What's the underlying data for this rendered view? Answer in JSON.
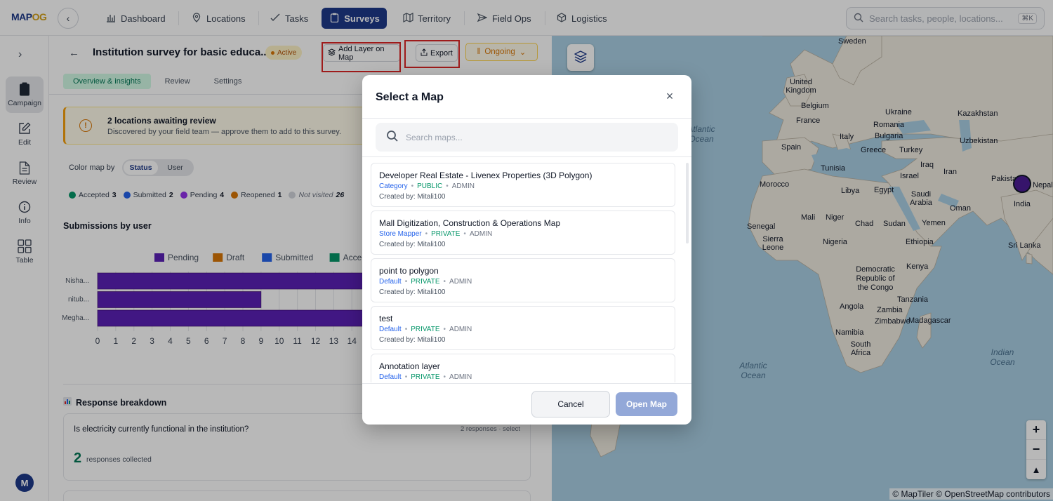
{
  "brand": {
    "logo_left": "MAP",
    "logo_accent": "OG"
  },
  "nav": {
    "items": [
      {
        "label": "Dashboard",
        "icon": "bar-chart-icon"
      },
      {
        "label": "Locations",
        "icon": "pin-icon"
      },
      {
        "label": "Tasks",
        "icon": "check-icon"
      },
      {
        "label": "Surveys",
        "icon": "clipboard-icon",
        "active": true
      },
      {
        "label": "Territory",
        "icon": "map-icon"
      },
      {
        "label": "Field Ops",
        "icon": "send-icon"
      },
      {
        "label": "Logistics",
        "icon": "cube-icon"
      }
    ],
    "search_placeholder": "Search tasks, people, locations...",
    "search_kbd": "⌘K"
  },
  "rail": {
    "items": [
      {
        "label": "Campaign",
        "icon": "clipboard-icon",
        "active": true
      },
      {
        "label": "Edit",
        "icon": "edit-icon"
      },
      {
        "label": "Review",
        "icon": "document-icon"
      },
      {
        "label": "Info",
        "icon": "info-icon"
      },
      {
        "label": "Table",
        "icon": "grid-icon"
      }
    ],
    "avatar": "M"
  },
  "survey": {
    "title": "Institution survey for basic educa...",
    "status_badge": "Active",
    "add_layer_label": "Add Layer on Map",
    "export_label": "Export",
    "ongoing_label": "Ongoing",
    "tabs": [
      "Overview & insights",
      "Review",
      "Settings"
    ],
    "alert": {
      "title": "2 locations awaiting review",
      "subtitle": "Discovered by your field team — approve them to add to this survey."
    },
    "color_map_by": "Color map by",
    "color_options": [
      "Status",
      "User"
    ],
    "status_legend": [
      {
        "label": "Accepted",
        "count": "3",
        "color": "#059669"
      },
      {
        "label": "Submitted",
        "count": "2",
        "color": "#2563eb"
      },
      {
        "label": "Pending",
        "count": "4",
        "color": "#9333ea"
      },
      {
        "label": "Reopened",
        "count": "1",
        "color": "#d97706"
      },
      {
        "label": "Not visited",
        "count": "26",
        "color": "#d1d5db"
      }
    ],
    "submissions_title": "Submissions by user",
    "response_title": "Response breakdown",
    "question": {
      "text": "Is electricity currently functional in the institution?",
      "meta": "2 responses · select",
      "count": "2",
      "count_label": "responses collected"
    }
  },
  "chart_data": {
    "type": "bar",
    "orientation": "horizontal",
    "stacked": true,
    "categories": [
      "Nisha...",
      "nitub...",
      "Megha..."
    ],
    "series": [
      {
        "name": "Pending",
        "color": "#5b21b6",
        "values": [
          15,
          9,
          15
        ]
      },
      {
        "name": "Draft",
        "color": "#d97706",
        "values": [
          0,
          0,
          0
        ]
      },
      {
        "name": "Submitted",
        "color": "#2563eb",
        "values": [
          0,
          0,
          0
        ]
      },
      {
        "name": "Accepted",
        "color": "#059669",
        "values": [
          0,
          0,
          0
        ]
      }
    ],
    "x_ticks": [
      0,
      1,
      2,
      3,
      4,
      5,
      6,
      7,
      8,
      9,
      10,
      11,
      12,
      13,
      14
    ],
    "xlim": [
      0,
      16
    ],
    "grid": true,
    "legend": "top"
  },
  "map": {
    "labels": [
      "Sweden",
      "United Kingdom",
      "Belgium",
      "France",
      "Ukraine",
      "Kazakhstan",
      "Romania",
      "Italy",
      "Bulgaria",
      "Spain",
      "Greece",
      "Turkey",
      "Uzbekistan",
      "Tunisia",
      "Iraq",
      "Iran",
      "Morocco",
      "Libya",
      "Egypt",
      "Israel",
      "Pakistan",
      "Saudi Arabia",
      "India",
      "Oman",
      "Mali",
      "Niger",
      "Chad",
      "Sudan",
      "Yemen",
      "Senegal",
      "Sierra Leone",
      "Nigeria",
      "Ethiopia",
      "Kenya",
      "Democratic Republic of the Congo",
      "Tanzania",
      "Angola",
      "Zambia",
      "Zimbabwe",
      "Madagascar",
      "Namibia",
      "South Africa",
      "Sri Lanka",
      "Nepal"
    ],
    "oceans": [
      "Atlantic Ocean",
      "Atlantic Ocean",
      "Indian Ocean"
    ],
    "attribution": "© MapTiler © OpenStreetMap contributors",
    "zoom_in": "+",
    "zoom_out": "−",
    "compass": "▲"
  },
  "modal": {
    "title": "Select a Map",
    "search_placeholder": "Search maps...",
    "items": [
      {
        "name": "Developer Real Estate - Livenex Properties (3D Polygon)",
        "category": "Category",
        "visibility": "PUBLIC",
        "role": "ADMIN",
        "created_by": "Created by: Mitali100"
      },
      {
        "name": "Mall Digitization, Construction & Operations Map",
        "category": "Store Mapper",
        "visibility": "PRIVATE",
        "role": "ADMIN",
        "created_by": "Created by: Mitali100"
      },
      {
        "name": "point to polygon",
        "category": "Default",
        "visibility": "PRIVATE",
        "role": "ADMIN",
        "created_by": "Created by: Mitali100"
      },
      {
        "name": "test",
        "category": "Default",
        "visibility": "PRIVATE",
        "role": "ADMIN",
        "created_by": "Created by: Mitali100"
      },
      {
        "name": "Annotation layer",
        "category": "Default",
        "visibility": "PRIVATE",
        "role": "ADMIN",
        "created_by": ""
      }
    ],
    "cancel_label": "Cancel",
    "open_label": "Open Map"
  }
}
